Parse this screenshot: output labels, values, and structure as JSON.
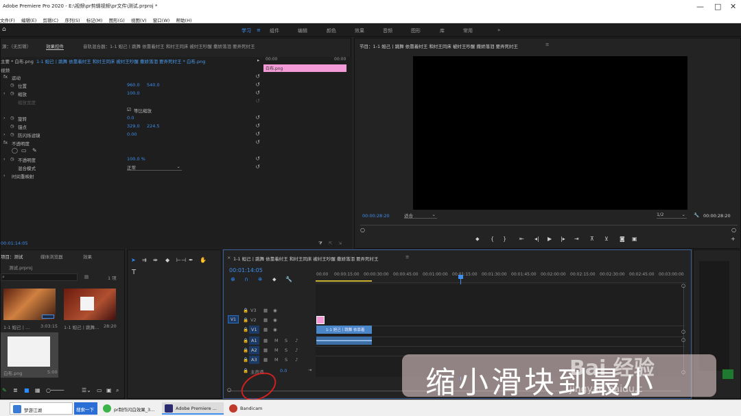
{
  "app": {
    "title": "Adobe Premiere Pro 2020 - E:\\视频\\pr剪辑视频\\pr文件\\测试.prproj *"
  },
  "menu": [
    "文件(F)",
    "编辑(E)",
    "剪辑(C)",
    "序列(S)",
    "标记(M)",
    "图形(G)",
    "视图(V)",
    "窗口(W)",
    "帮助(H)"
  ],
  "workspaces": [
    "学习",
    "组件",
    "编辑",
    "颜色",
    "效果",
    "音频",
    "图形",
    "库",
    "常用"
  ],
  "effect_panel": {
    "tabs": [
      "源：（无剪辑）",
      "效果控件",
      "音轨混合器：1-1 妲己丨跳舞 依靠着纣王 和纣王同床 被纣王吵醒 撒娇落泪 要弄死纣王"
    ],
    "clip_path": "主要 * 白布.png",
    "seq_path": "1-1 妲己丨跳舞 依靠着纣王 和纣王同床 被纣王吵醒 撒娇落泪 要弄死纣王 * 白布.png",
    "time_start": "00:00",
    "time_end": "00:00",
    "clip_name": "白布.png",
    "video_label": "视频",
    "motion": "运动",
    "position": {
      "label": "位置",
      "x": "960.0",
      "y": "540.0"
    },
    "scale": {
      "label": "缩放",
      "value": "100.0"
    },
    "scale_width": {
      "label": "缩放宽度"
    },
    "uniform_scale": "等比缩放",
    "rotation": {
      "label": "旋转",
      "value": "0.0"
    },
    "anchor": {
      "label": "锚点",
      "x": "329.0",
      "y": "224.5"
    },
    "anti_flicker": {
      "label": "防闪烁滤镜",
      "value": "0.00"
    },
    "opacity_group": "不透明度",
    "opacity": {
      "label": "不透明度",
      "value": "100.0 %"
    },
    "blend": {
      "label": "混合模式",
      "value": "正常"
    },
    "time_remap": "时间重映射",
    "current_time": "00:01:14:05"
  },
  "program": {
    "title": "节目：1-1 妲己丨跳舞 依靠着纣王 和纣王同床 被纣王吵醒 撒娇落泪 要弄死纣王",
    "timecode": "00:00:28:20",
    "fit": "适合",
    "quality": "1/2",
    "duration": "00:00:28:20"
  },
  "project": {
    "tabs": [
      "项目：测试",
      "媒体浏览器",
      "效果"
    ],
    "file": "测试.prproj",
    "count": "1 项",
    "items": [
      {
        "name": "1-1 妲己丨...",
        "dur": "3:03:15"
      },
      {
        "name": "1-1 妲己丨跳舞...",
        "dur": "28:20"
      },
      {
        "name": "白布.png",
        "dur": "5:00"
      }
    ]
  },
  "timeline": {
    "title": "1-1 妲己丨跳舞 依靠着纣王 和纣王同床 被纣王吵醒 撒娇落泪 要弄死纣王",
    "timecode": "00:01:14:05",
    "ruler": [
      "00:00",
      "00:00:15:00",
      "00:00:30:00",
      "00:00:45:00",
      "00:01:00:00",
      "00:01:15:00",
      "00:01:30:00",
      "00:01:45:00",
      "00:02:00:00",
      "00:02:15:00",
      "00:02:30:00",
      "00:02:45:00",
      "00:03:00:00"
    ],
    "tracks": [
      "V3",
      "V2",
      "V1",
      "A1",
      "A2",
      "A3"
    ],
    "source_v": "V1",
    "master": "主声道",
    "master_val": "0.0",
    "clip_label": "1-1 妲己丨跳舞 依靠着"
  },
  "overlay": {
    "caption": "缩小滑块到最小",
    "watermark": "Bai 经验",
    "url": "jingyan.baidu.c"
  },
  "taskbar": [
    {
      "label": "梦游江湖",
      "color": "#3a7bd5"
    },
    {
      "label": "搜索一下",
      "color": "#2b6fd6"
    },
    {
      "label": "pr制作闪白效果_3...",
      "color": "#3cb44b"
    },
    {
      "label": "Adobe Premiere ...",
      "color": "#2a2a6e"
    },
    {
      "label": "Bandicam",
      "color": "#c0392b"
    }
  ],
  "colors": {
    "accent": "#2d8cff",
    "clip_pink": "#f29bd6",
    "audio_clip": "#4a86c8"
  }
}
